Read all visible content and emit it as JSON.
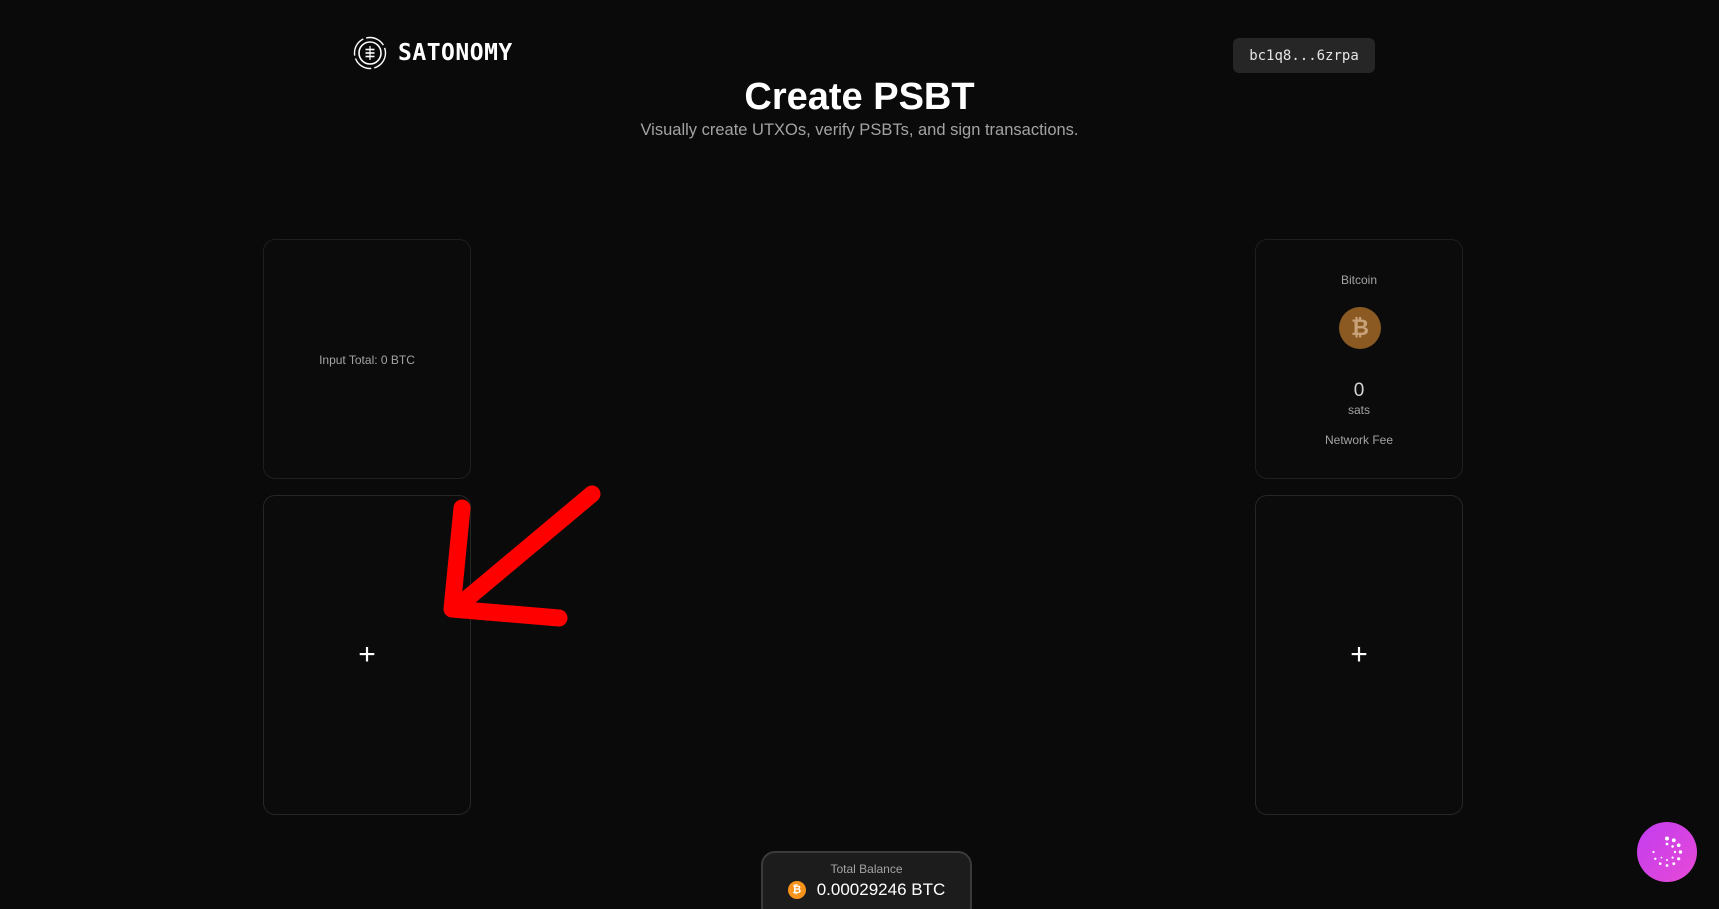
{
  "header": {
    "brand": "SATONOMY",
    "wallet_address": "bc1q8...6zrpa"
  },
  "hero": {
    "title": "Create PSBT",
    "subtitle": "Visually create UTXOs, verify PSBTs, and sign transactions."
  },
  "inputs": {
    "total_label": "Input Total: 0 BTC",
    "add_symbol": "+"
  },
  "outputs": {
    "fee_asset": "Bitcoin",
    "fee_coin_symbol": "₿",
    "fee_value": "0",
    "fee_unit": "sats",
    "fee_label": "Network Fee",
    "add_symbol": "+"
  },
  "balance": {
    "label": "Total Balance",
    "coin_symbol": "₿",
    "value": "0.00029246 BTC"
  },
  "colors": {
    "background": "#0a0a0a",
    "bitcoin_orange": "#f7931a",
    "annotation_red": "#ff0000",
    "assistant_gradient_start": "#c13cf0",
    "assistant_gradient_end": "#e84ad6"
  },
  "icons": {
    "logo": "satonomy-logo-icon",
    "fee_coin": "bitcoin-icon",
    "balance_coin": "bitcoin-icon",
    "assistant": "assistant-icon"
  }
}
